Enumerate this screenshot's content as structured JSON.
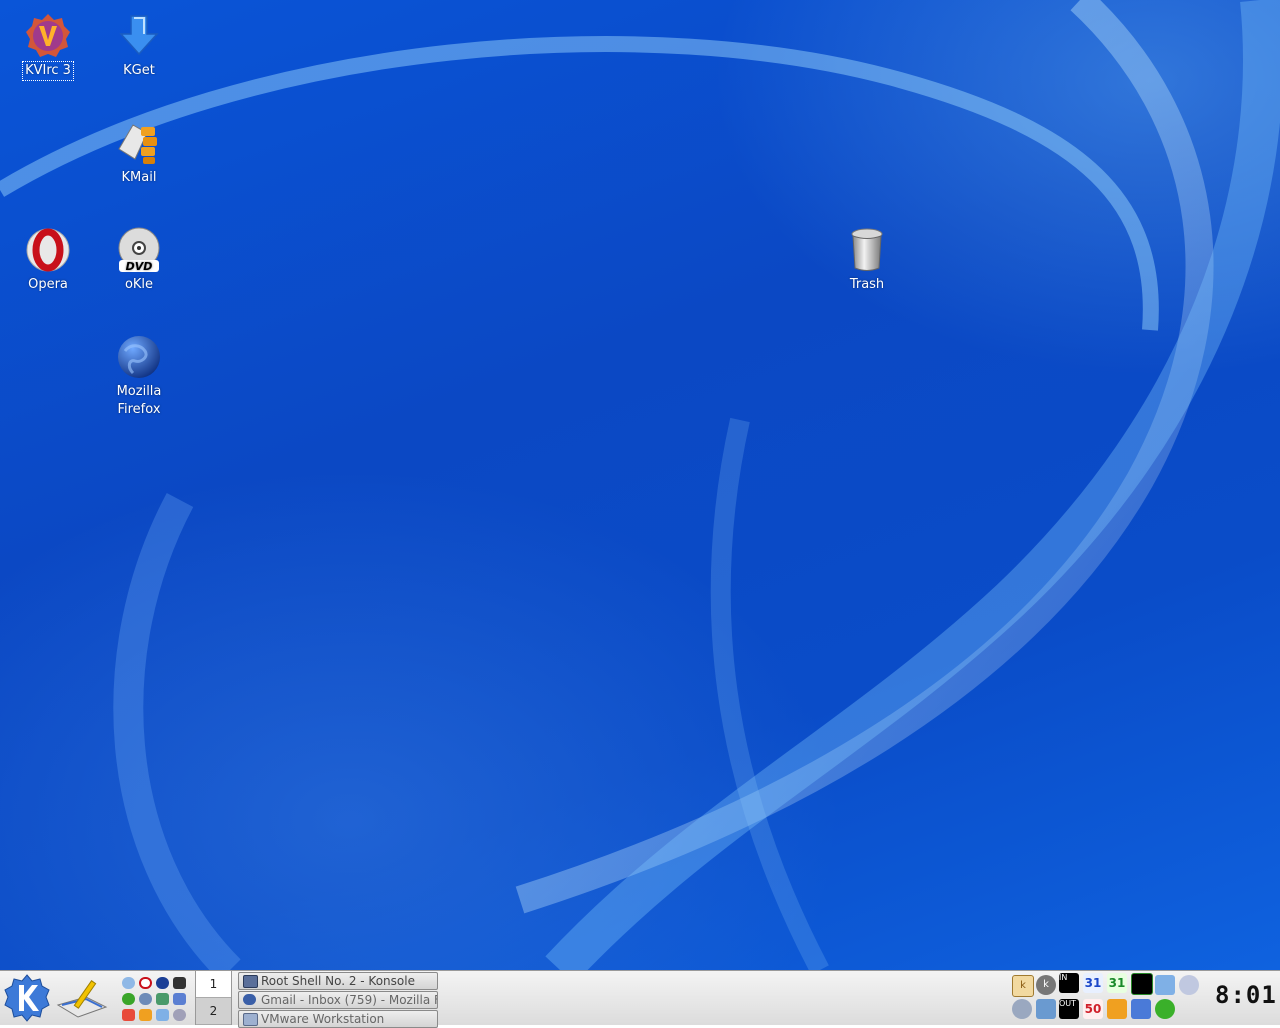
{
  "desktop": {
    "icons": [
      {
        "label": "KVIrc 3",
        "icon": "kvirc-icon",
        "selected": true
      },
      {
        "label": "KGet",
        "icon": "kget-download-icon"
      },
      {
        "label": "KMail",
        "icon": "kmail-icon"
      },
      {
        "label": "Opera",
        "icon": "opera-icon"
      },
      {
        "label": "oKle",
        "icon": "dvd-disc-icon"
      },
      {
        "label": "Mozilla Firefox",
        "icon": "firefox-globe-icon"
      },
      {
        "label": "Trash",
        "icon": "trash-can-icon"
      }
    ],
    "wallpaper_color": "#0b4fcf"
  },
  "taskbar": {
    "kmenu_icon": "kde-k-menu-icon",
    "pager": {
      "desktops": [
        "1",
        "2"
      ],
      "active": "1"
    },
    "tasks": [
      {
        "label": "Root Shell No. 2 - Konsole",
        "icon": "konsole-icon"
      },
      {
        "label": "Gmail - Inbox (759) - Mozilla F",
        "icon": "firefox-icon"
      },
      {
        "label": "VMware Workstation",
        "icon": "vmware-icon"
      }
    ],
    "tray": {
      "in_label": "IN",
      "out_label": "OUT",
      "calendar_1": "31",
      "calendar_2": "31",
      "battery_value": "50"
    },
    "clock": "8:01"
  }
}
